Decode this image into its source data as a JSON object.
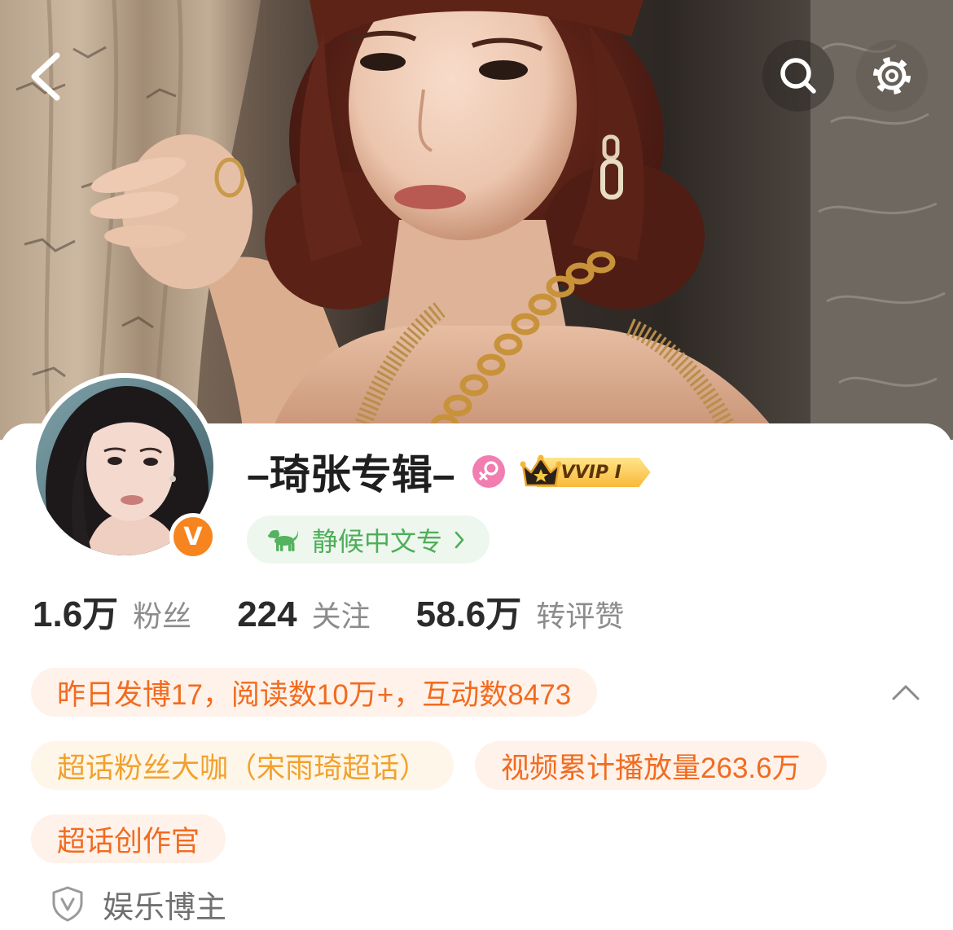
{
  "nav": {
    "back_icon": "chevron-left-icon",
    "search_icon": "search-icon",
    "settings_icon": "gear-icon"
  },
  "profile": {
    "username": "–琦张专辑–",
    "verified_badge": "V",
    "gender_icon": "female-icon",
    "vip_icon": "crown-icon",
    "vip_level": "VVIP I",
    "fan_group": {
      "icon": "dog-icon",
      "label": "静候中文专",
      "arrow_icon": "chevron-right-icon"
    }
  },
  "stats": [
    {
      "value": "1.6万",
      "label": "粉丝"
    },
    {
      "value": "224",
      "label": "关注"
    },
    {
      "value": "58.6万",
      "label": "转评赞"
    }
  ],
  "summary": {
    "text": "昨日发博17，阅读数10万+，互动数8473",
    "toggle_icon": "chevron-up-icon"
  },
  "tags": [
    {
      "text": "超话粉丝大咖（宋雨琦超话）",
      "color": "#F2A12E"
    },
    {
      "text": "视频累计播放量263.6万",
      "color": "#F26B1F"
    },
    {
      "text": "超话创作官",
      "color": "#F26B1F"
    }
  ],
  "category": {
    "icon": "shield-v-icon",
    "label": "娱乐博主"
  },
  "colors": {
    "accent_orange": "#F26B1F",
    "tag_gold": "#F2A12E",
    "fan_group_green": "#4FAE58",
    "verified_orange": "#F6851F",
    "female_pink": "#F27DB0",
    "vip_gold": "#F9C23C"
  }
}
